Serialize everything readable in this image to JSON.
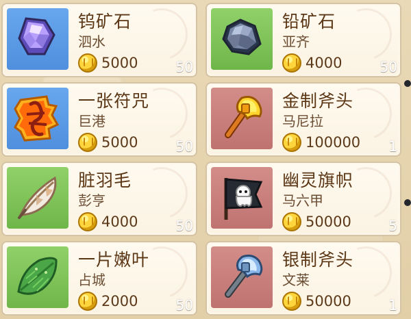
{
  "items": [
    {
      "name": "钨矿石",
      "location": "泗水",
      "price": "5000",
      "quantity": "50",
      "icon": "tungsten-ore-icon",
      "bg": "#5d99e6"
    },
    {
      "name": "铅矿石",
      "location": "亚齐",
      "price": "4000",
      "quantity": "50",
      "icon": "lead-ore-icon",
      "bg": "#7dc55d"
    },
    {
      "name": "一张符咒",
      "location": "巨港",
      "price": "5000",
      "quantity": "50",
      "icon": "talisman-icon",
      "bg": "#5d99e6"
    },
    {
      "name": "金制斧头",
      "location": "马尼拉",
      "price": "100000",
      "quantity": "1",
      "icon": "gold-axe-icon",
      "bg": "#c78380"
    },
    {
      "name": "脏羽毛",
      "location": "彭亨",
      "price": "4000",
      "quantity": "50",
      "icon": "dirty-feather-icon",
      "bg": "#7dc55d"
    },
    {
      "name": "幽灵旗帜",
      "location": "马六甲",
      "price": "50000",
      "quantity": "5",
      "icon": "ghost-flag-icon",
      "bg": "#c78380"
    },
    {
      "name": "一片嫩叶",
      "location": "占城",
      "price": "2000",
      "quantity": "50",
      "icon": "tender-leaf-icon",
      "bg": "#7dc55d"
    },
    {
      "name": "银制斧头",
      "location": "文莱",
      "price": "50000",
      "quantity": "1",
      "icon": "silver-axe-icon",
      "bg": "#c78380"
    }
  ]
}
